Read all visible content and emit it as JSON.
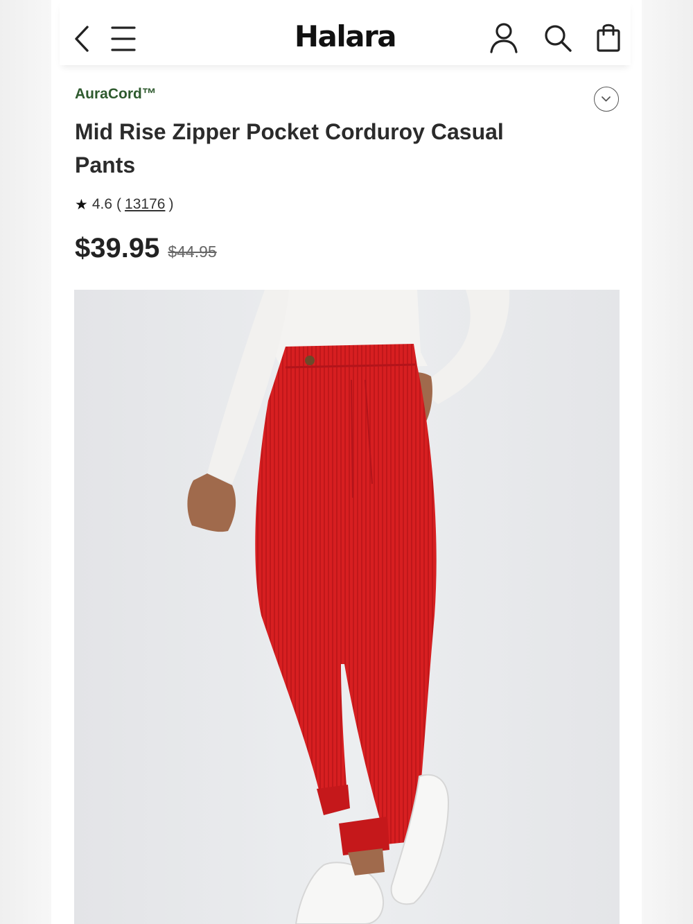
{
  "header": {
    "logo": "Halara",
    "icons": [
      "back-icon",
      "menu-icon",
      "account-icon",
      "search-icon",
      "shopping-bag-icon"
    ]
  },
  "product": {
    "brand": "AuraCord™",
    "title": "Mid Rise Zipper Pocket Corduroy Casual Pants",
    "rating": {
      "value": "4.6",
      "open": "(",
      "count": "13176",
      "close": ")"
    },
    "price": "$39.95",
    "original_price": "$44.95",
    "image_icon": "product-photo-red-corduroy-pants"
  },
  "colors": {
    "brand_green": "#2e5a2e",
    "pants_red": "#d61d1f",
    "text": "#1e1e1e"
  }
}
